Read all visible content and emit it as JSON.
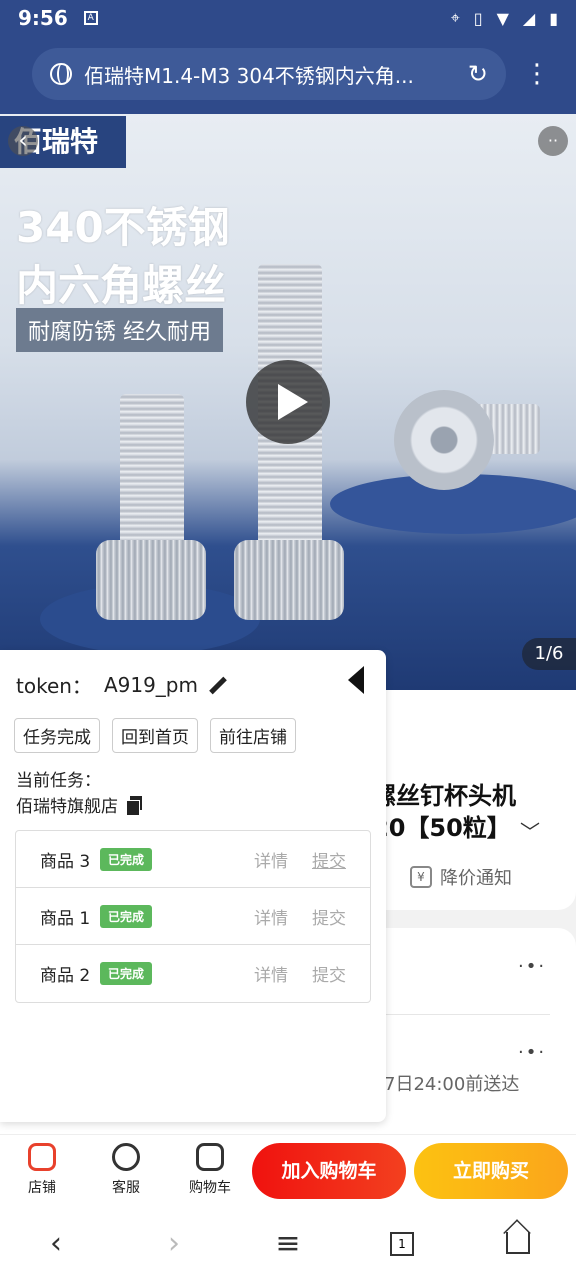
{
  "status_bar": {
    "time": "9:56"
  },
  "browser": {
    "title": "佰瑞特M1.4-M3 304不锈钢内六角..."
  },
  "hero": {
    "brand": "佰瑞特",
    "headline_1": "340不锈钢",
    "headline_2": "内六角螺丝",
    "tagline": "耐腐防锈 经久耐用",
    "counter": "1/6"
  },
  "product": {
    "title_line1": "螺丝钉杯头机",
    "title_line2": "20【50粒】",
    "price_notify": "降价通知",
    "delivery": "7日24:00前送达"
  },
  "panel": {
    "token_label": "token：",
    "token_value": "A919_pm",
    "buttons": [
      "任务完成",
      "回到首页",
      "前往店铺"
    ],
    "current_task_label": "当前任务：",
    "current_task_value": "佰瑞特旗舰店",
    "tasks": [
      {
        "name": "商品 3",
        "status": "已完成",
        "detail": "详情",
        "submit": "提交"
      },
      {
        "name": "商品 1",
        "status": "已完成",
        "detail": "详情",
        "submit": "提交"
      },
      {
        "name": "商品 2",
        "status": "已完成",
        "detail": "详情",
        "submit": "提交"
      }
    ]
  },
  "action_bar": {
    "store": "店铺",
    "service": "客服",
    "cart": "购物车",
    "add_to_cart": "加入购物车",
    "buy_now": "立即购买"
  },
  "nav": {
    "tabs_count": "1"
  },
  "colors": {
    "accent_red": "#f0120f",
    "accent_yellow": "#fcc211",
    "done_green": "#5cb85c"
  }
}
